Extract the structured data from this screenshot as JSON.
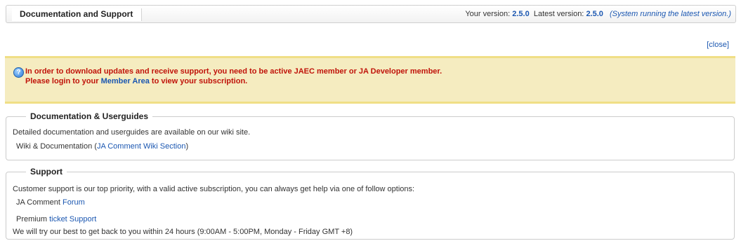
{
  "header": {
    "title": "Documentation and Support",
    "your_version_label": "Your version:",
    "your_version": "2.5.0",
    "latest_version_label": "Latest version:",
    "latest_version": "2.5.0",
    "status": "(System running the latest version.)"
  },
  "close_link": "[close]",
  "notice": {
    "icon": "info-icon",
    "line1": "In order to download updates and receive support, you need to be active JAEC member or JA Developer member.",
    "line2_pre": "Please login to your ",
    "line2_link": "Member Area",
    "line2_post": " to view your subscription."
  },
  "documentation": {
    "legend": "Documentation & Userguides",
    "description": "Detailed documentation and userguides are available on our wiki site.",
    "wiki_label": "Wiki & Documentation (",
    "wiki_link": "JA Comment Wiki Section",
    "wiki_suffix": ")"
  },
  "support": {
    "legend": "Support",
    "description": "Customer support is our top priority, with a valid active subscription, you can always get help via one of follow options:",
    "forum_label": "JA Comment ",
    "forum_link": "Forum",
    "ticket_label": "Premium ",
    "ticket_link": "ticket Support",
    "hours": "We will try our best to get back to you within 24 hours (9:00AM - 5:00PM, Monday - Friday GMT +8)"
  },
  "colors": {
    "link": "#1b57b1",
    "alert_text": "#c0130a",
    "notice_bg": "#f5ecc0",
    "notice_border": "#f0df86"
  }
}
